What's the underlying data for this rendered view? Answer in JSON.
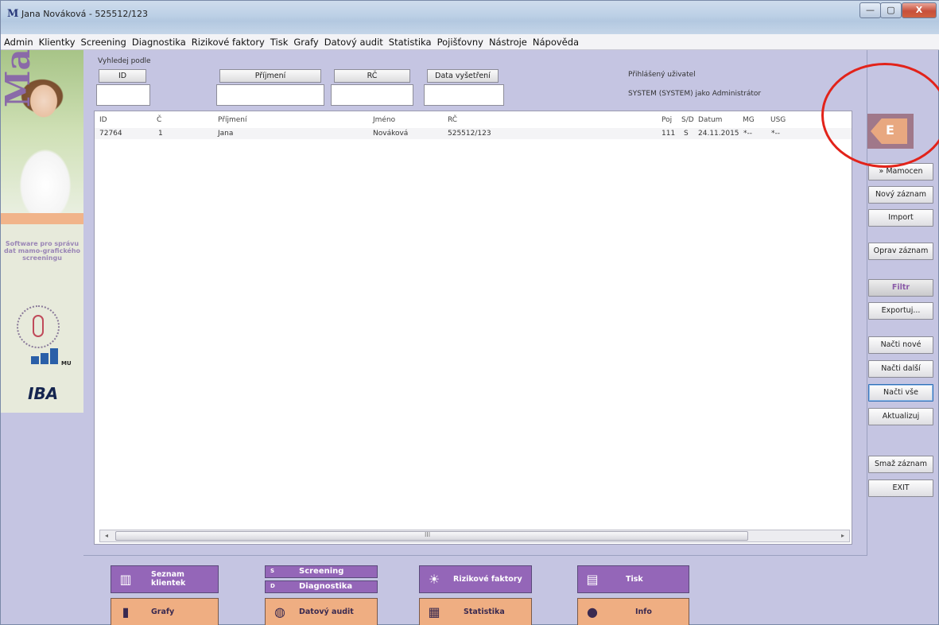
{
  "window": {
    "title": "Jana Nováková - 525512/123",
    "logo": "M",
    "controls": [
      "—",
      "▢",
      "X"
    ]
  },
  "menu": [
    "Admin",
    "Klientky",
    "Screening",
    "Diagnostika",
    "Rizikové faktory",
    "Tisk",
    "Grafy",
    "Datový audit",
    "Statistika",
    "Pojišťovny",
    "Nástroje",
    "Nápověda"
  ],
  "banner": {
    "brand": "MaSc",
    "subtitle": "Software pro správu dat mamo-grafického screeningu",
    "iba": "IBA",
    "mu": "MU"
  },
  "search": {
    "caption": "Vyhledej podle",
    "buttons": [
      "ID",
      "Příjmení",
      "RČ",
      "Data vyšetření"
    ],
    "values": [
      "",
      "",
      "",
      ""
    ]
  },
  "login": {
    "caption": "Přihlášený uživatel",
    "user": "SYSTEM (SYSTEM) jako Administrátor"
  },
  "grid": {
    "columns": [
      "ID",
      "Č",
      "Příjmení",
      "Jméno",
      "RČ",
      "Poj",
      "S/D",
      "Datum",
      "MG",
      "USG"
    ],
    "rows": [
      [
        "72764",
        "1",
        "Jana",
        "Nováková",
        "525512/123",
        "111",
        "S",
        "24.11.2015",
        "*--",
        "*--"
      ]
    ],
    "scroll_grip": "III"
  },
  "right_panel": {
    "logo_letter": "E",
    "buttons": {
      "mamocentrum": "» Mamocen",
      "novy": "Nový záznam",
      "import": "Import",
      "oprav": "Oprav záznam",
      "filtr": "Filtr",
      "exportuj": "Exportuj...",
      "nacti_nove": "Načti nové",
      "nacti_dalsi": "Načti další",
      "nacti_vse": "Načti vše",
      "aktualizuj": "Aktualizuj",
      "smaz": "Smaž záznam",
      "exit": "EXIT"
    }
  },
  "nav": {
    "seznam": "Seznam klientek",
    "screening_key": "S",
    "screening": "Screening",
    "diagnostika_key": "D",
    "diagnostika": "Diagnostika",
    "rizikove": "Rizikové faktory",
    "tisk": "Tisk",
    "grafy": "Grafy",
    "datovy_audit": "Datový audit",
    "statistika": "Statistika",
    "info": "Info"
  },
  "colors": {
    "nav_purple": "#9466b8",
    "nav_orange": "#efae82",
    "panel_bg": "#c5c5e2",
    "highlight_circle": "#e2231a"
  }
}
